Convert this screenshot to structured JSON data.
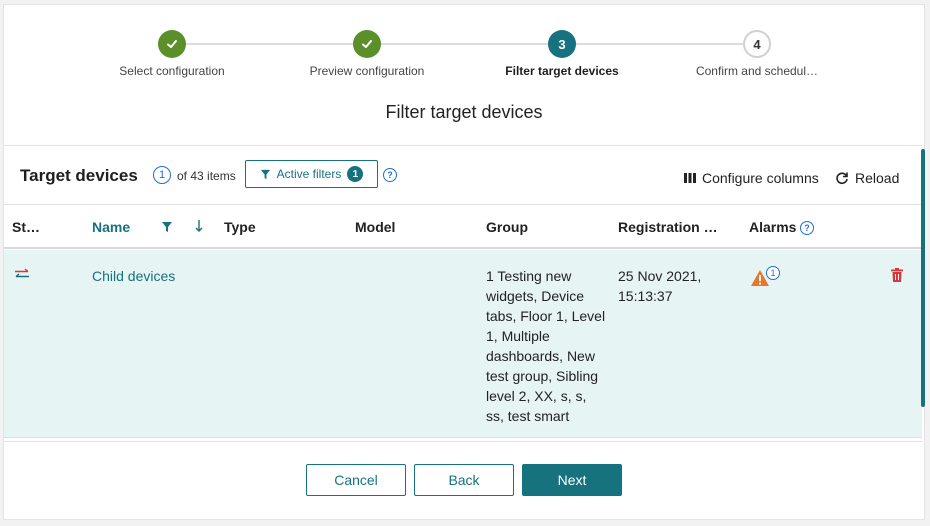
{
  "stepper": {
    "steps": [
      {
        "number": "1",
        "label": "Select configuration",
        "state": "done"
      },
      {
        "number": "2",
        "label": "Preview configuration",
        "state": "done"
      },
      {
        "number": "3",
        "label": "Filter target devices",
        "state": "active"
      },
      {
        "number": "4",
        "label": "Confirm and schedul…",
        "state": "todo"
      }
    ]
  },
  "heading": "Filter target devices",
  "toolbar": {
    "title": "Target devices",
    "count_badge": "1",
    "count_text": "of 43 items",
    "active_filters_label": "Active filters",
    "active_filters_count": "1",
    "configure_columns_label": "Configure columns",
    "reload_label": "Reload"
  },
  "table": {
    "columns": {
      "status": "St…",
      "name": "Name",
      "type": "Type",
      "model": "Model",
      "group": "Group",
      "registration": "Registration …",
      "alarms": "Alarms"
    },
    "rows": [
      {
        "name": "Child devices",
        "type": "",
        "model": "",
        "group": "1 Testing new widgets, Device tabs, Floor 1, Level 1, Multiple dashboards, New test group, Sibling level 2, XX, s, s, ss, test smart",
        "registration": "25 Nov 2021, 15:13:37",
        "alarm_count": "1"
      }
    ]
  },
  "footer": {
    "cancel_label": "Cancel",
    "back_label": "Back",
    "next_label": "Next"
  },
  "colors": {
    "primary": "#16727f",
    "done": "#5a8f29",
    "warning": "#e8762d",
    "danger": "#d9363e",
    "row_highlight": "#e6f4f4"
  }
}
